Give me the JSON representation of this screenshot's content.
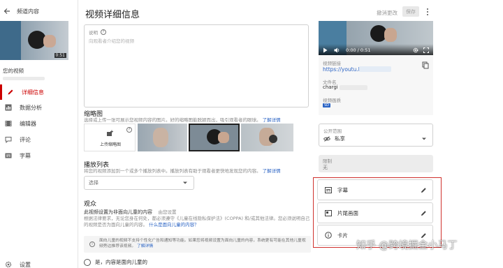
{
  "sidebar": {
    "back_title": "频道内容",
    "video_duration": "0:51",
    "your_video_label": "您的视频",
    "items": [
      {
        "label": "详细信息",
        "active": true
      },
      {
        "label": "数据分析"
      },
      {
        "label": "编辑器"
      },
      {
        "label": "评论"
      },
      {
        "label": "字幕"
      },
      {
        "label": "设置"
      }
    ]
  },
  "header": {
    "title": "视频详细信息",
    "undo_label": "撤消更改",
    "save_label": "保存"
  },
  "description": {
    "label": "说明",
    "placeholder": "向观看者介绍您的视频"
  },
  "thumbnail": {
    "title": "缩略图",
    "help": "选择或上传一张可展示您视频内容的图片。好的缩略图能脱颖而出，吸引观看者的眼球。",
    "learn_more": "了解详情",
    "upload_label": "上传缩略图"
  },
  "playlist": {
    "title": "播放列表",
    "help": "将您的视频添加到一个或多个播放列表中。播放列表有助于观看者更快地发现您的内容。",
    "learn_more": "了解详情",
    "select_placeholder": "选择"
  },
  "audience": {
    "title": "观众",
    "subtitle": "此视频设置为非面向儿童的内容",
    "set_by": "由您设置",
    "help": "根据法律要求，无论您身在何处，都必须遵守《儿童在线隐私保护法》(COPPA) 和/或其他法律。您必须说明自己的视频是否为面向儿童的内容。",
    "help_link": "什么是面向儿童的内容？",
    "notice": "面向儿童的视频不支持个性化广告和通知等功能。如果您将视频设置为面向儿童的内容，系统更有可能在其他儿童视频旁边推荐该视频。",
    "notice_link": "了解详情",
    "option_yes": "是，内容是面向儿童的"
  },
  "preview": {
    "time": "0:00 / 0:51",
    "link_label": "视频链接",
    "link_value": "https://youtu.be",
    "file_label": "文件名",
    "file_value": "chargi",
    "quality_label": "视频画质",
    "quality_badge": "SD"
  },
  "visibility": {
    "label": "公开范围",
    "value": "私享"
  },
  "restrictions": {
    "label": "限制",
    "value": "无"
  },
  "cards": [
    {
      "label": "字幕",
      "icon": "subtitles-icon"
    },
    {
      "label": "片尾画面",
      "icon": "end-screen-icon"
    },
    {
      "label": "卡片",
      "icon": "info-icon"
    }
  ],
  "watermark": "知乎 @跨境掘金小马丁",
  "colors": {
    "accent": "#cc0000",
    "link": "#2a63c4",
    "highlight_border": "#d0312d"
  }
}
